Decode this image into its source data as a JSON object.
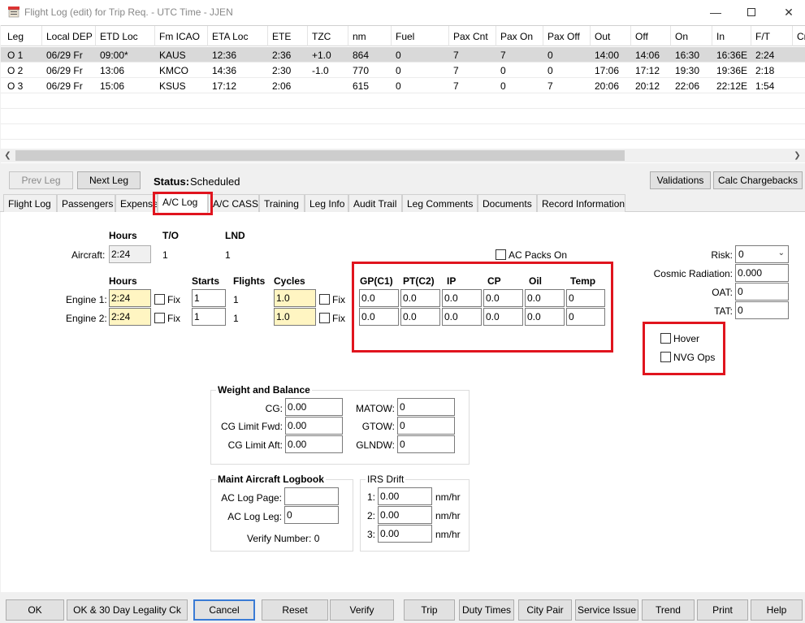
{
  "window": {
    "title": "Flight Log (edit) for Trip Req. - UTC Time - JJEN"
  },
  "grid": {
    "headers": [
      "Leg",
      "Local DEP",
      "ETD Loc",
      "Fm ICAO",
      "ETA Loc",
      "ETE",
      "TZC",
      "nm",
      "Fuel",
      "Pax Cnt",
      "Pax On",
      "Pax Off",
      "Out",
      "Off",
      "On",
      "In",
      "F/T",
      "Cr"
    ],
    "rows": [
      [
        "O 1",
        "06/29 Fr",
        "09:00*",
        "KAUS",
        "12:36",
        "2:36",
        "+1.0",
        "864",
        "0",
        "7",
        "7",
        "0",
        "14:00",
        "14:06",
        "16:30",
        "16:36E",
        "2:24",
        ""
      ],
      [
        "O 2",
        "06/29 Fr",
        "13:06",
        "KMCO",
        "14:36",
        "2:30",
        "-1.0",
        "770",
        "0",
        "7",
        "0",
        "0",
        "17:06",
        "17:12",
        "19:30",
        "19:36E",
        "2:18",
        ""
      ],
      [
        "O 3",
        "06/29 Fr",
        "15:06",
        "KSUS",
        "17:12",
        "2:06",
        "",
        "615",
        "0",
        "7",
        "0",
        "7",
        "20:06",
        "20:12",
        "22:06",
        "22:12E",
        "1:54",
        ""
      ]
    ]
  },
  "nav": {
    "prev_leg": "Prev Leg",
    "next_leg": "Next Leg",
    "status_label": "Status:",
    "status_value": "Scheduled",
    "validations": "Validations",
    "calc_chargebacks": "Calc Chargebacks"
  },
  "tabs": [
    "Flight Log",
    "Passengers",
    "Expenses",
    "A/C Log",
    "A/C CASS",
    "Training",
    "Leg Info",
    "Audit Trail",
    "Leg Comments",
    "Documents",
    "Record Information"
  ],
  "aclog": {
    "hours_hdr": "Hours",
    "to_hdr": "T/O",
    "lnd_hdr": "LND",
    "aircraft_label": "Aircraft:",
    "aircraft_hours": "2:24",
    "aircraft_to": "1",
    "aircraft_lnd": "1",
    "engine_hours_hdr": "Hours",
    "starts_hdr": "Starts",
    "flights_hdr": "Flights",
    "cycles_hdr": "Cycles",
    "engine1_label": "Engine 1:",
    "engine1_hours": "2:24",
    "engine1_starts": "1",
    "engine1_flights": "1",
    "engine1_cycles": "1.0",
    "engine2_label": "Engine 2:",
    "engine2_hours": "2:24",
    "engine2_starts": "1",
    "engine2_flights": "1",
    "engine2_cycles": "1.0",
    "fix_label": "Fix",
    "ac_packs_on": "AC Packs On",
    "gauges": {
      "headers": [
        "GP(C1)",
        "PT(C2)",
        "IP",
        "CP",
        "Oil",
        "Temp"
      ],
      "row1": [
        "0.0",
        "0.0",
        "0.0",
        "0.0",
        "0.0",
        "0"
      ],
      "row2": [
        "0.0",
        "0.0",
        "0.0",
        "0.0",
        "0.0",
        "0"
      ]
    },
    "risk_label": "Risk:",
    "risk_value": "0",
    "cosmic_label": "Cosmic Radiation:",
    "cosmic_value": "0.000",
    "oat_label": "OAT:",
    "oat_value": "0",
    "tat_label": "TAT:",
    "tat_value": "0",
    "hover_label": "Hover",
    "nvg_label": "NVG Ops"
  },
  "wb": {
    "title": "Weight and Balance",
    "cg_label": "CG:",
    "cg": "0.00",
    "cg_fwd_label": "CG Limit Fwd:",
    "cg_fwd": "0.00",
    "cg_aft_label": "CG Limit Aft:",
    "cg_aft": "0.00",
    "matow_label": "MATOW:",
    "matow": "0",
    "gtow_label": "GTOW:",
    "gtow": "0",
    "glndw_label": "GLNDW:",
    "glndw": "0"
  },
  "maint": {
    "title": "Maint Aircraft Logbook",
    "page_label": "AC Log Page:",
    "page": "",
    "leg_label": "AC Log Leg:",
    "leg": "0",
    "verify_label": "Verify Number: 0"
  },
  "irs": {
    "title": "IRS Drift",
    "l1": "1:",
    "v1": "0.00",
    "l2": "2:",
    "v2": "0.00",
    "l3": "3:",
    "v3": "0.00",
    "unit": "nm/hr"
  },
  "bottom": [
    "OK",
    "OK & 30 Day Legality Ck",
    "Cancel",
    "Reset",
    "Verify",
    "Trip",
    "Duty Times",
    "City Pair",
    "Service Issue",
    "Trend",
    "Print",
    "Help"
  ]
}
